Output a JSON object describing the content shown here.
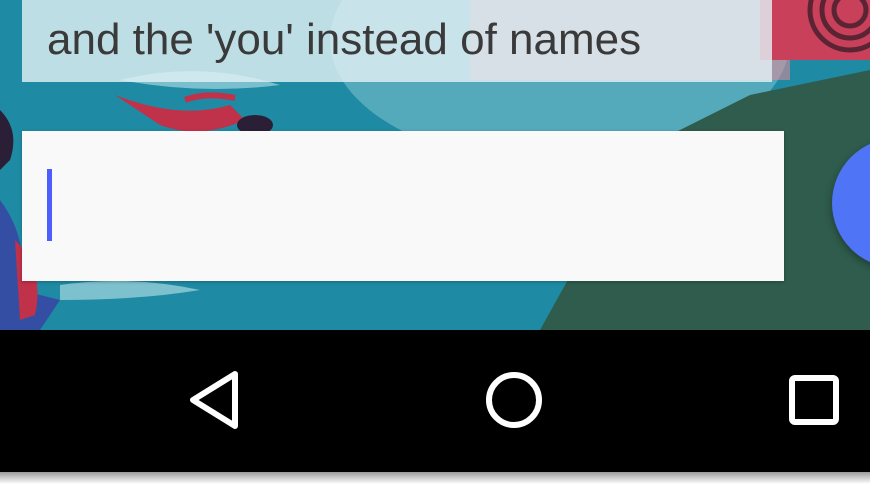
{
  "conversation": {
    "last_message_fragment": "and the 'you' instead of names"
  },
  "reply": {
    "value": ""
  },
  "navigation": {
    "back": "back-icon",
    "home": "home-icon",
    "recents": "recents-icon"
  },
  "colors": {
    "wallpaper_teal": "#1f8aa3",
    "input_background": "#f9f9f9",
    "caret": "#4f5dff",
    "fab": "#4f74f5",
    "navbar": "#000000"
  }
}
